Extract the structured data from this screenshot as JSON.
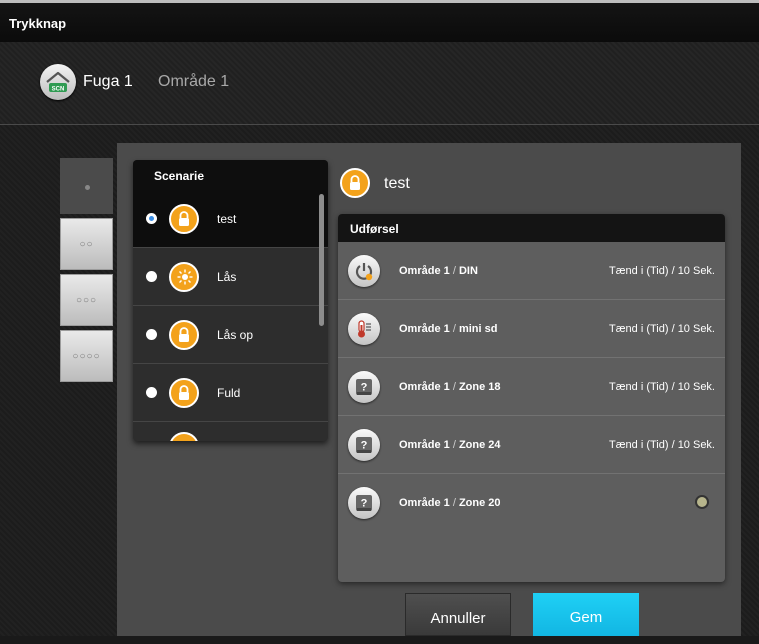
{
  "window": {
    "title": "Trykknap"
  },
  "header": {
    "device_name": "Fuga 1",
    "area_name": "Område 1",
    "icon": "scn-house-icon",
    "icon_text": "SCN"
  },
  "side_tabs": [
    {
      "label": "•",
      "icon": "one-dot"
    },
    {
      "label": "••",
      "icon": "two-dots"
    },
    {
      "label": "•••",
      "icon": "three-dots"
    },
    {
      "label": "••••",
      "icon": "four-dots"
    }
  ],
  "scenario_list": {
    "header": "Scenarie",
    "items": [
      {
        "label": "test",
        "selected": true,
        "icon": "lock-icon"
      },
      {
        "label": "Lås",
        "selected": false,
        "icon": "snow-sun-icon"
      },
      {
        "label": "Lås op",
        "selected": false,
        "icon": "lock-icon"
      },
      {
        "label": "Fuld",
        "selected": false,
        "icon": "lock-icon"
      }
    ]
  },
  "selected_scenario": {
    "title": "test",
    "icon": "lock-icon"
  },
  "output": {
    "header": "Udførsel",
    "rows": [
      {
        "area": "Område 1",
        "separator": "/",
        "device": "DIN",
        "state": "Tænd i (Tid) / 10 Sek.",
        "icon": "power-icon"
      },
      {
        "area": "Område 1",
        "separator": "/",
        "device": "mini sd",
        "state": "Tænd i (Tid) / 10 Sek.",
        "icon": "thermometer-icon"
      },
      {
        "area": "Område 1",
        "separator": "/",
        "device": "Zone 18",
        "state": "Tænd i (Tid) / 10 Sek.",
        "icon": "unknown-device-icon"
      },
      {
        "area": "Område 1",
        "separator": "/",
        "device": "Zone 24",
        "state": "Tænd i (Tid) / 10 Sek.",
        "icon": "unknown-device-icon"
      },
      {
        "area": "Område 1",
        "separator": "/",
        "device": "Zone 20",
        "state": "",
        "icon": "unknown-device-icon"
      }
    ]
  },
  "buttons": {
    "cancel": "Annuller",
    "save": "Gem"
  },
  "colors": {
    "accent_orange": "#f3a21b",
    "save_button": "#1fd0f5",
    "selected_radio": "#3a8ee6"
  }
}
